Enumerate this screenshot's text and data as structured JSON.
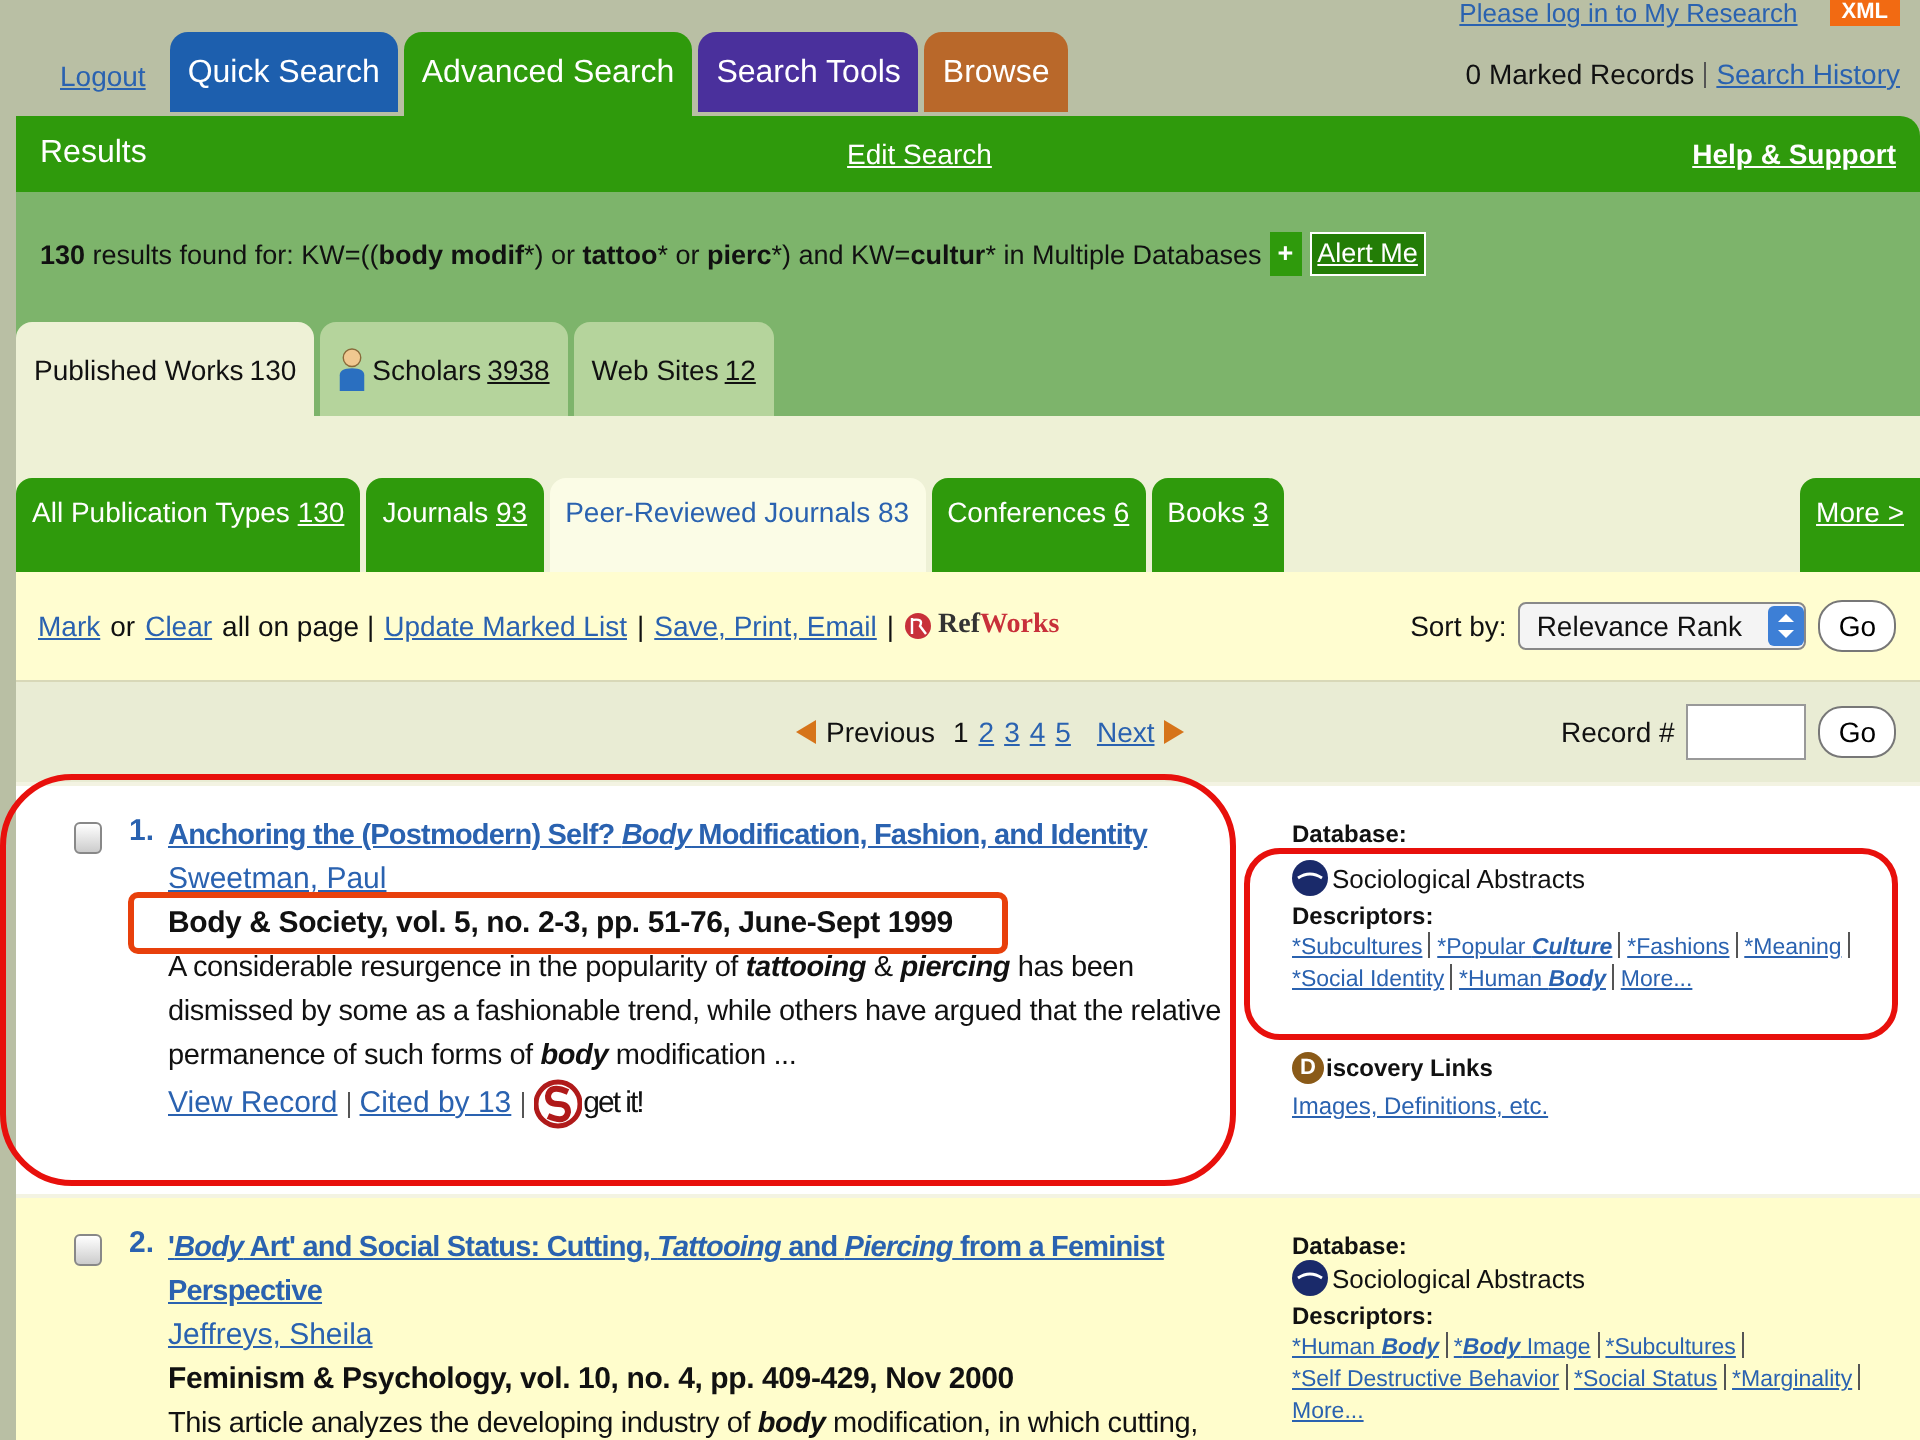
{
  "top_links": {
    "login": "Please log in to My Research",
    "xml": "XML",
    "logout": "Logout",
    "marked": "0 Marked Records",
    "history": "Search History"
  },
  "main_tabs": [
    {
      "label": "Quick Search",
      "color": "#1d5fae",
      "selected": false
    },
    {
      "label": "Advanced Search",
      "color": "#2f9a0c",
      "selected": true
    },
    {
      "label": "Search Tools",
      "color": "#4a309c",
      "selected": false
    },
    {
      "label": "Browse",
      "color": "#b9682a",
      "selected": false
    }
  ],
  "results_bar": {
    "title": "Results",
    "edit": "Edit Search",
    "help": "Help & Support"
  },
  "query": [
    {
      "text": "130",
      "bold": true
    },
    {
      "text": " results found for: KW=(("
    },
    {
      "text": "body modif",
      "bold": true
    },
    {
      "text": "*) or "
    },
    {
      "text": "tattoo",
      "bold": true
    },
    {
      "text": "* or "
    },
    {
      "text": "pierc",
      "bold": true
    },
    {
      "text": "*) and KW="
    },
    {
      "text": "cultur",
      "bold": true
    },
    {
      "text": "* in Multiple Databases"
    }
  ],
  "query_actions": {
    "plus": "+",
    "alert": "Alert Me"
  },
  "category_tabs": [
    {
      "label": "Published Works",
      "count": "130",
      "selected": true,
      "kind": "plain"
    },
    {
      "label": "Scholars",
      "count": "3938",
      "selected": false,
      "kind": "person"
    },
    {
      "label": "Web Sites",
      "count": "12",
      "selected": false,
      "kind": "plain"
    }
  ],
  "type_tabs": [
    {
      "label": "All Publication Types",
      "count": "130",
      "selected": false
    },
    {
      "label": "Journals",
      "count": "93",
      "selected": false
    },
    {
      "label": "Peer-Reviewed Journals",
      "count": "83",
      "selected": true
    },
    {
      "label": "Conferences",
      "count": "6",
      "selected": false
    },
    {
      "label": "Books",
      "count": "3",
      "selected": false
    }
  ],
  "more_tab": "More >",
  "toolbar": {
    "mark": "Mark",
    "or": "or",
    "clear": "Clear",
    "all_on_page": "all on page |",
    "update": "Update Marked List",
    "sep1": "|",
    "save": "Save, Print, Email",
    "sep2": "|",
    "refworks": [
      "Ref",
      "Works"
    ],
    "sort_label": "Sort by:",
    "sort_value": "Relevance Rank",
    "go": "Go"
  },
  "pager": {
    "previous": "Previous",
    "pages": [
      {
        "label": "1",
        "selected": true
      },
      {
        "label": "2",
        "selected": false
      },
      {
        "label": "3",
        "selected": false
      },
      {
        "label": "4",
        "selected": false
      },
      {
        "label": "5",
        "selected": false
      }
    ],
    "next": "Next",
    "record_label": "Record #",
    "go": "Go"
  },
  "records": [
    {
      "number": "1.",
      "highlighted": true,
      "checked": false,
      "title": [
        "Anchoring the (Postmodern) Self? ",
        {
          "text": "Body",
          "italic": true
        },
        " Modification, Fashion, and Identity"
      ],
      "author": "Sweetman, Paul",
      "source": "Body & Society, vol. 5, no. 2-3, pp. 51-76, June-Sept 1999",
      "source_highlighted": true,
      "abstract": [
        "A considerable resurgence in the popularity of ",
        {
          "text": "tattooing",
          "bold": true,
          "italic": true
        },
        " & ",
        {
          "text": "piercing",
          "bold": true,
          "italic": true
        },
        " has been dismissed by some as a fashionable trend, while others have argued that the relative permanence of such forms of ",
        {
          "text": "body",
          "bold": true,
          "italic": true
        },
        " modification ..."
      ],
      "links": [
        "View Record",
        "Cited by 13"
      ],
      "getit": "get it!",
      "database_label": "Database:",
      "database": "Sociological Abstracts",
      "descriptors_label": "Descriptors:",
      "database_highlighted": true,
      "descriptors": [
        [
          "*Subcultures"
        ],
        [
          "*Popular ",
          {
            "text": "Culture",
            "bold": true,
            "italic": true
          }
        ],
        [
          "*Fashions"
        ],
        [
          "*Meaning"
        ],
        [
          "*Social Identity"
        ],
        [
          "*Human ",
          {
            "text": "Body",
            "bold": true,
            "italic": true
          }
        ]
      ],
      "descriptors_more": "More...",
      "discovery": {
        "badge": "D",
        "title": "iscovery Links",
        "link": "Images, Definitions, etc."
      }
    },
    {
      "number": "2.",
      "highlighted": false,
      "checked": false,
      "title": [
        "'",
        {
          "text": "Body",
          "italic": true
        },
        " Art' and Social Status: Cutting, ",
        {
          "text": "Tattooing",
          "italic": true
        },
        " and ",
        {
          "text": "Piercing",
          "italic": true
        },
        " from a Feminist Perspective"
      ],
      "author": "Jeffreys, Sheila",
      "source": "Feminism & Psychology, vol. 10, no. 4, pp. 409-429, Nov 2000",
      "source_highlighted": false,
      "abstract": [
        "This article analyzes the developing industry of ",
        {
          "text": "body",
          "bold": true,
          "italic": true
        },
        " modification, in which cutting,"
      ],
      "database_label": "Database:",
      "database": "Sociological Abstracts",
      "descriptors_label": "Descriptors:",
      "database_highlighted": false,
      "descriptors": [
        [
          "*Human ",
          {
            "text": "Body",
            "bold": true,
            "italic": true
          }
        ],
        [
          "*",
          {
            "text": "Body",
            "bold": true,
            "italic": true
          },
          " Image"
        ],
        [
          "*Subcultures"
        ],
        [
          "*Self Destructive Behavior"
        ],
        [
          "*Social Status"
        ],
        [
          "*Marginality"
        ]
      ],
      "descriptors_more": "More..."
    }
  ]
}
